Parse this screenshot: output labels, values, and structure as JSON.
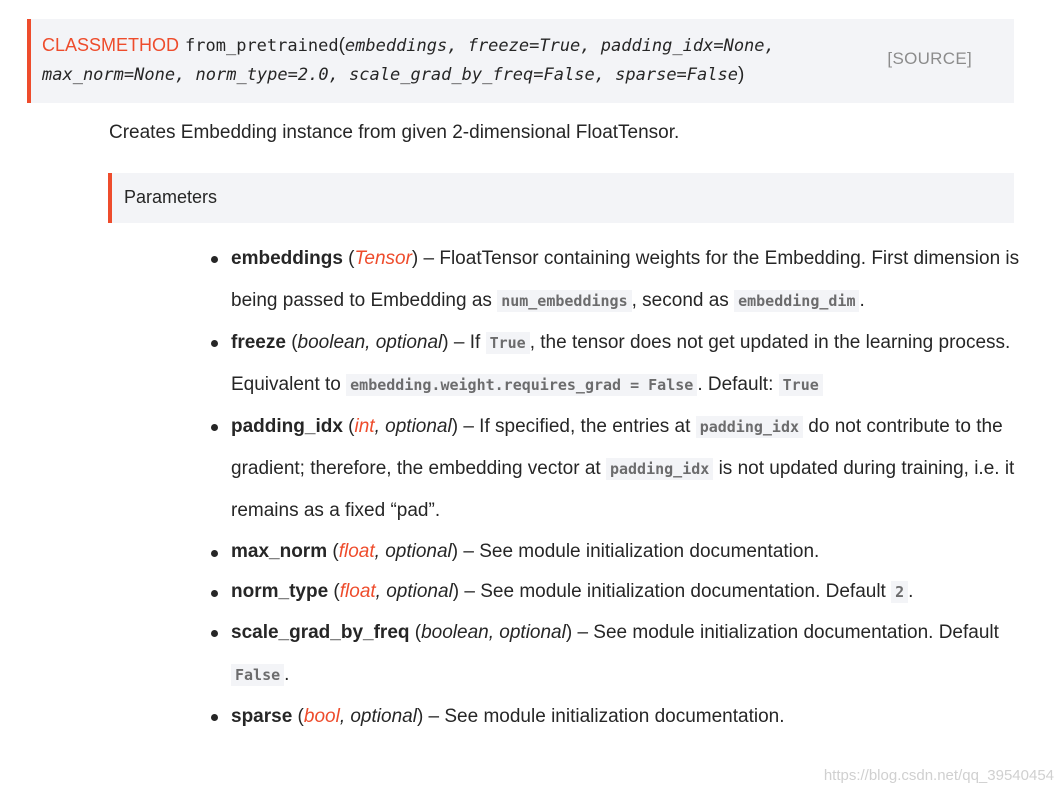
{
  "signature": {
    "keyword": "CLASSMETHOD",
    "name": "from_pretrained",
    "open_paren": "(",
    "close_paren": ")",
    "line1_args": "embeddings, freeze=True, padding_idx=None,",
    "line2_args": "max_norm=None, norm_type=2.0, scale_grad_by_freq=False, sparse=False",
    "source_label": "[SOURCE]"
  },
  "description": "Creates Embedding instance from given 2-dimensional FloatTensor.",
  "parameters": {
    "header": "Parameters",
    "items": [
      {
        "name": "embeddings",
        "type": "Tensor",
        "text_a": ") – FloatTensor containing weights for the Embedding. First dimension is being passed to Embedding as ",
        "code_a": "num_embeddings",
        "text_b": ", second as ",
        "code_b": "embedding_dim",
        "text_c": "."
      },
      {
        "name": "freeze",
        "type": "boolean, optional",
        "text_a": ") – If ",
        "code_a": "True",
        "text_b": ", the tensor does not get updated in the learning process. Equivalent to ",
        "code_b": "embedding.weight.requires_grad = False",
        "text_c": ". Default: ",
        "code_c": "True"
      },
      {
        "name": "padding_idx",
        "type_link": "int",
        "type_rest": ", optional",
        "text_a": ") – If specified, the entries at ",
        "code_a": "padding_idx",
        "text_b": " do not contribute to the gradient; therefore, the embedding vector at ",
        "code_b": "padding_idx",
        "text_c": " is not updated during training, i.e. it remains as a fixed “pad”."
      },
      {
        "name": "max_norm",
        "type_link": "float",
        "type_rest": ", optional",
        "text_a": ") – See module initialization documentation."
      },
      {
        "name": "norm_type",
        "type_link": "float",
        "type_rest": ", optional",
        "text_a": ") – See module initialization documentation. Default ",
        "code_a": "2",
        "text_b": "."
      },
      {
        "name": "scale_grad_by_freq",
        "type": "boolean, optional",
        "text_a": ") – See module initialization documentation. Default ",
        "code_a": "False",
        "text_b": "."
      },
      {
        "name": "sparse",
        "type_link": "bool",
        "type_rest": ", optional",
        "text_a": ") – See module initialization documentation."
      }
    ]
  },
  "watermark": "https://blog.csdn.net/qq_39540454",
  "colors": {
    "accent": "#ee4c2c",
    "panel": "#f3f4f7",
    "text": "#262626",
    "code_text": "#6c6c6d",
    "source": "#8c8c8c"
  }
}
